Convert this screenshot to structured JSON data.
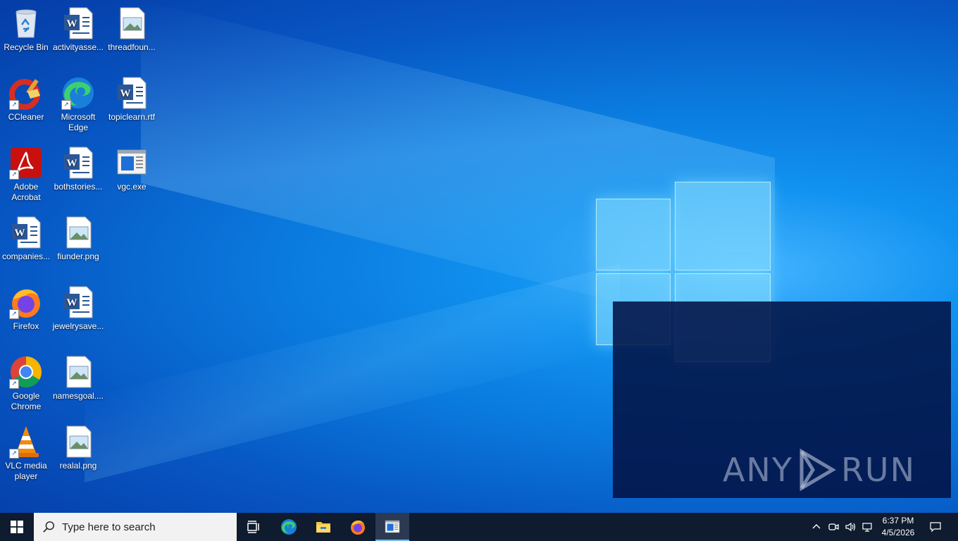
{
  "desktop": {
    "icons": [
      {
        "label": "Recycle Bin"
      },
      {
        "label": "activityasse..."
      },
      {
        "label": "threadfoun..."
      },
      {
        "label": "CCleaner"
      },
      {
        "label": "Microsoft Edge"
      },
      {
        "label": "topiclearn.rtf"
      },
      {
        "label": "Adobe Acrobat"
      },
      {
        "label": "bothstories..."
      },
      {
        "label": "vgc.exe"
      },
      {
        "label": "companies..."
      },
      {
        "label": "fiunder.png"
      },
      {
        "label": "Firefox"
      },
      {
        "label": "jewelrysave..."
      },
      {
        "label": "Google Chrome"
      },
      {
        "label": "namesgoal...."
      },
      {
        "label": "VLC media player"
      },
      {
        "label": "realal.png"
      }
    ]
  },
  "watermark": {
    "text_left": "ANY",
    "text_right": "RUN"
  },
  "taskbar": {
    "search_placeholder": "Type here to search",
    "pinned": [
      "task-view",
      "microsoft-edge",
      "file-explorer",
      "firefox",
      "vgc-app"
    ],
    "clock": {
      "time": "6:37 PM",
      "date": "4/5/2026"
    }
  },
  "colors": {
    "taskbar_bg": "#0f1b2e",
    "accent": "#76b9ed",
    "desktop_blue": "#0a79dd"
  }
}
